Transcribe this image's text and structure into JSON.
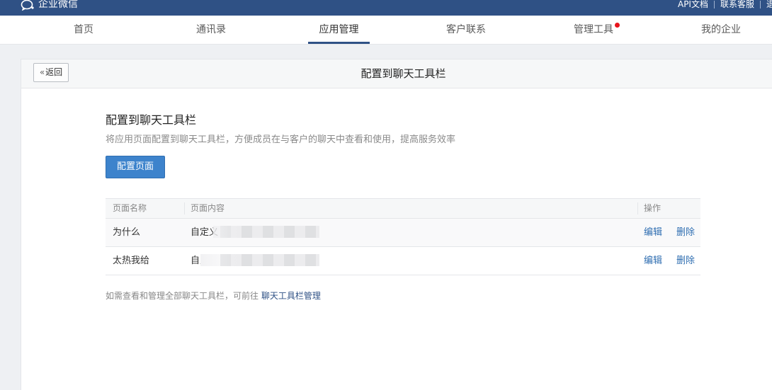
{
  "brand": {
    "name": "企业微信"
  },
  "top_links": [
    "API文档",
    "联系客服",
    "退"
  ],
  "nav": {
    "items": [
      "首页",
      "通讯录",
      "应用管理",
      "客户联系",
      "管理工具",
      "我的企业"
    ],
    "active": "应用管理"
  },
  "panel": {
    "back_label": "返回",
    "title": "配置到聊天工具栏"
  },
  "section": {
    "title": "配置到聊天工具栏",
    "description": "将应用页面配置到聊天工具栏，方便成员在与客户的聊天中查看和使用，提高服务效率",
    "config_button": "配置页面"
  },
  "table": {
    "headers": [
      "页面名称",
      "页面内容",
      "操作"
    ],
    "rows": [
      {
        "name": "为什么",
        "content_prefix": "自定义",
        "edit": "编辑",
        "delete": "删除"
      },
      {
        "name": "太热我给",
        "content_prefix": "自定义",
        "edit": "编辑",
        "delete": "删除"
      }
    ]
  },
  "footer": {
    "text": "如需查看和管理全部聊天工具栏，可前往",
    "link": "聊天工具栏管理"
  },
  "colors": {
    "topbar": "#2f5185",
    "primary_button": "#3d83cc",
    "link": "#2f6eb1",
    "notification_dot": "#e8141c"
  }
}
